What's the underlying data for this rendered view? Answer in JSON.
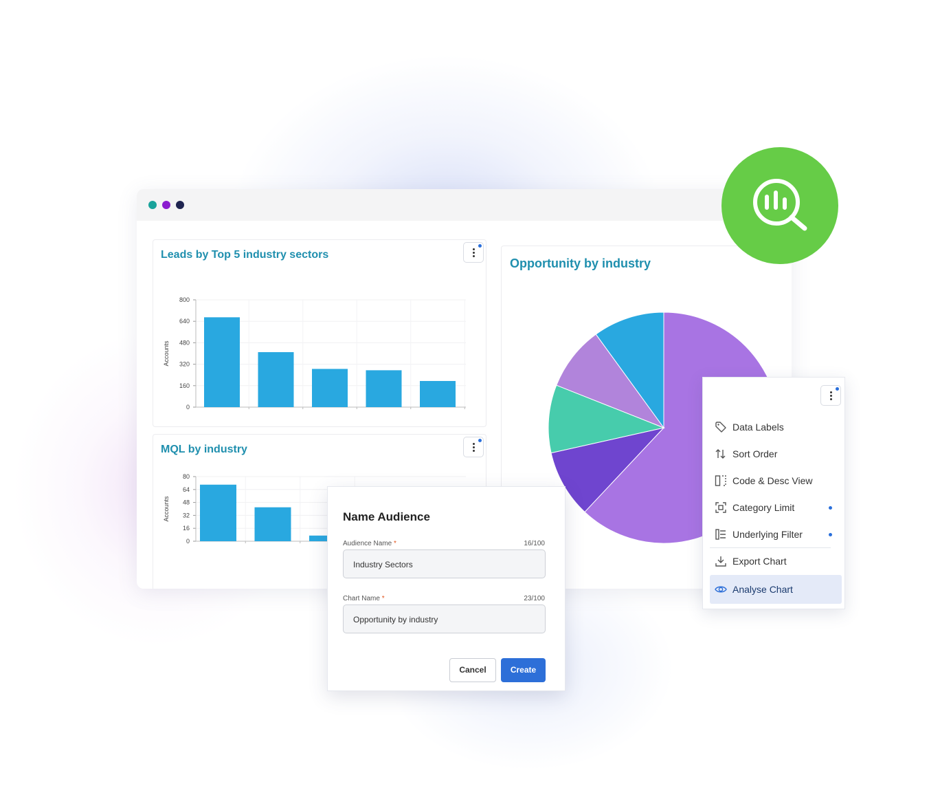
{
  "window": {
    "dots": [
      {
        "name": "teal-dot",
        "color": "#1aa39b"
      },
      {
        "name": "purple-dot",
        "color": "#8b1ccf"
      },
      {
        "name": "navy-dot",
        "color": "#1f2450"
      }
    ]
  },
  "colors": {
    "title_teal": "#1f8fae",
    "bar_blue": "#29a8e0",
    "badge_green": "#66cc47",
    "primary_blue": "#2d6fd8"
  },
  "cards": {
    "leads": {
      "title": "Leads by Top 5 industry sectors"
    },
    "mql": {
      "title": "MQL by industry"
    },
    "opportunity": {
      "title": "Opportunity by industry"
    }
  },
  "chart_data": [
    {
      "type": "bar",
      "title": "Leads by Top 5 industry sectors",
      "ylabel": "Accounts",
      "ylim": [
        0,
        800
      ],
      "yticks": [
        0,
        160,
        320,
        480,
        640,
        800
      ],
      "values": [
        670,
        410,
        285,
        275,
        195
      ],
      "grid": true
    },
    {
      "type": "bar",
      "title": "MQL by industry",
      "ylabel": "Accounts",
      "ylim": [
        0,
        80
      ],
      "yticks": [
        0,
        16,
        32,
        48,
        64,
        80
      ],
      "values": [
        70,
        42,
        7
      ],
      "grid": true
    },
    {
      "type": "pie",
      "title": "Opportunity by industry",
      "slices": [
        {
          "value": 0.62,
          "color": "#a874e3"
        },
        {
          "value": 0.095,
          "color": "#6f45cf"
        },
        {
          "value": 0.095,
          "color": "#47ccac"
        },
        {
          "value": 0.09,
          "color": "#b184db"
        },
        {
          "value": 0.1,
          "color": "#29a8e0"
        }
      ]
    }
  ],
  "menu": {
    "items": [
      {
        "label": "Data Labels",
        "icon": "tag-icon",
        "dot": false,
        "active": false
      },
      {
        "label": "Sort Order",
        "icon": "sort-arrows-icon",
        "dot": false,
        "active": false
      },
      {
        "label": "Code & Desc View",
        "icon": "columns-icon",
        "dot": false,
        "active": false
      },
      {
        "label": "Category Limit",
        "icon": "focus-frame-icon",
        "dot": true,
        "active": false
      },
      {
        "label": "Underlying Filter",
        "icon": "filter-tree-icon",
        "dot": true,
        "active": false
      },
      {
        "label": "Export Chart",
        "icon": "download-icon",
        "dot": false,
        "active": false
      },
      {
        "label": "Analyse Chart",
        "icon": "eye-icon",
        "dot": false,
        "active": true
      }
    ]
  },
  "modal": {
    "title": "Name Audience",
    "audience_label": "Audience Name",
    "audience_count": "16/100",
    "audience_value": "Industry Sectors",
    "chart_label": "Chart Name",
    "chart_count": "23/100",
    "chart_value": "Opportunity by industry",
    "cancel": "Cancel",
    "create": "Create"
  },
  "badge": {
    "icon": "chart-magnifier-icon"
  }
}
